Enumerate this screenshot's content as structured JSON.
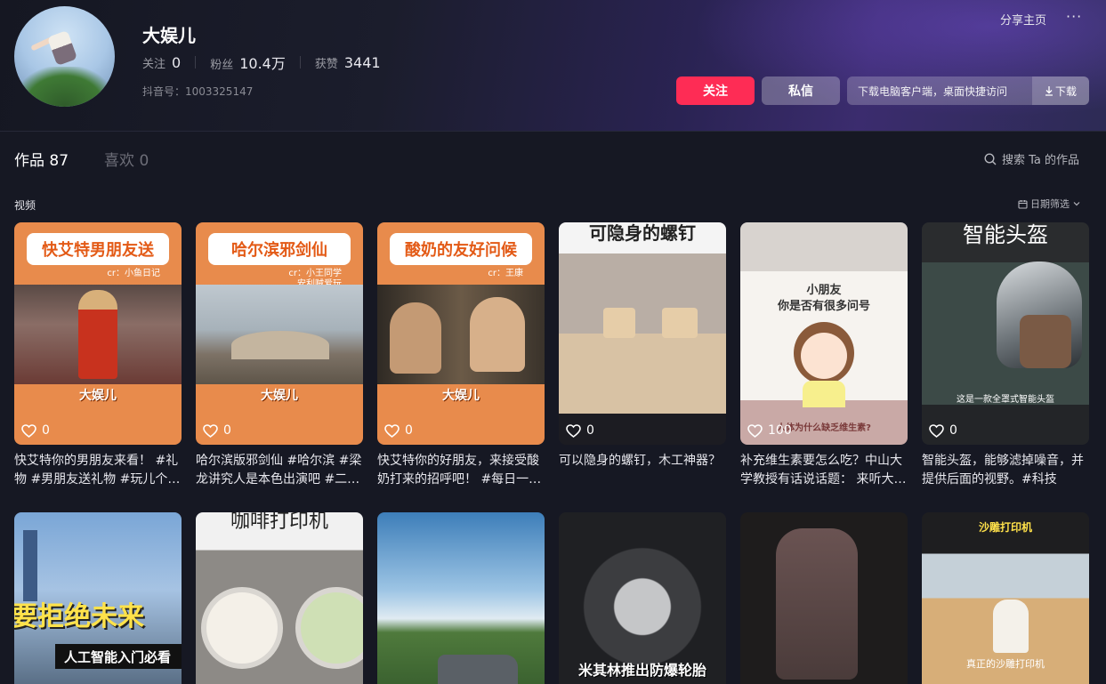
{
  "profile": {
    "name": "大娱儿",
    "following_label": "关注",
    "following": "0",
    "fans_label": "粉丝",
    "fans": "10.4万",
    "likes_label": "获赞",
    "likes": "3441",
    "douyin_id": "抖音号：1003325147",
    "share": "分享主页",
    "more": "···"
  },
  "actions": {
    "follow": "关注",
    "message": "私信",
    "download_text": "下载电脑客户端，桌面快捷访问",
    "download_btn": "下载"
  },
  "tabs": {
    "works": "作品 87",
    "likes": "喜欢 0",
    "search": "搜索 Ta 的作品"
  },
  "section": {
    "label": "视频",
    "filter": "日期筛选"
  },
  "videos": [
    {
      "likes": "0",
      "title": "快艾特你的男朋友来看！ #礼物 #男朋友送礼物 #玩儿个…",
      "caption": "快艾特男朋友送",
      "credit": "cr：小鱼日记",
      "logo": "大娱儿"
    },
    {
      "likes": "0",
      "title": "哈尔滨版邪剑仙 #哈尔滨 #梁龙讲究人是本色出演吧 #二…",
      "caption": "哈尔滨邪剑仙",
      "credit": "cr：小王同学\n安利贼爱玩",
      "logo": "大娱儿"
    },
    {
      "likes": "0",
      "title": "快艾特你的好朋友，来接受酸奶打来的招呼吧！ #每日一…",
      "caption": "酸奶的友好问候",
      "credit": "cr：王康",
      "logo": "大娱儿"
    },
    {
      "likes": "0",
      "title": "可以隐身的螺钉，木工神器？",
      "overlay": "可隐身的螺钉"
    },
    {
      "likes": "100",
      "title": "补充维生素要怎么吃？中山大学教授有话说话题： 来听大…",
      "overlay": "小朋友\n你是否有很多问号",
      "sub": "人体为什么缺乏维生素?"
    },
    {
      "likes": "0",
      "title": "智能头盔，能够滤掉噪音，并提供后面的视野。#科技",
      "overlay": "智能头盔",
      "sub": "这是一款全罩式智能头盔"
    }
  ],
  "videos_row2": [
    {
      "overlay": "要拒绝未来",
      "sub": "人工智能入门必看"
    },
    {
      "overlay": "咖啡打印机"
    },
    {
      "overlay": ""
    },
    {
      "overlay": "米其林推出防爆轮胎"
    },
    {
      "overlay": ""
    },
    {
      "overlay": "沙雕打印机",
      "sub": "真正的沙雕打印机"
    }
  ],
  "colors": {
    "accent": "#fe2c55",
    "background": "#161823",
    "orange_template": "#e88b4c"
  }
}
